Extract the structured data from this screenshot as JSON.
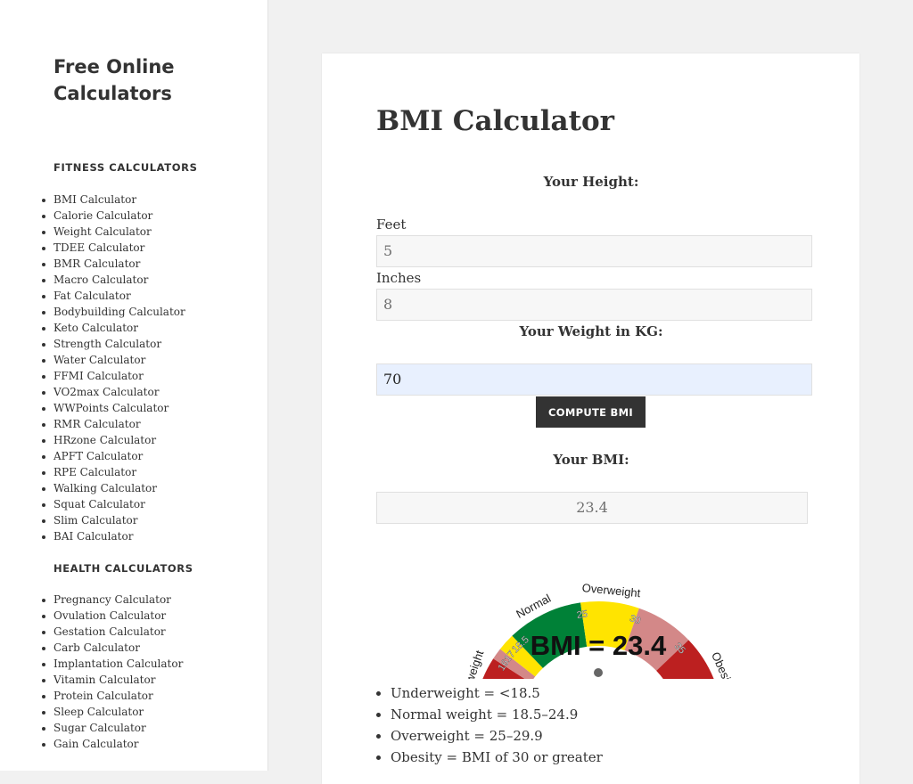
{
  "site": {
    "title_line1": "Free Online",
    "title_line2": "Calculators"
  },
  "sidebar": {
    "fitness_title": "FITNESS CALCULATORS",
    "fitness_items": [
      "BMI Calculator",
      "Calorie Calculator",
      "Weight Calculator",
      "TDEE Calculator",
      "BMR Calculator",
      "Macro Calculator",
      "Fat Calculator",
      "Bodybuilding Calculator",
      "Keto Calculator",
      "Strength Calculator",
      "Water Calculator",
      "FFMI Calculator",
      "VO2max Calculator",
      "WWPoints Calculator",
      "RMR Calculator",
      "HRzone Calculator",
      "APFT Calculator",
      "RPE Calculator",
      "Walking Calculator",
      "Squat Calculator",
      "Slim Calculator",
      "BAI Calculator"
    ],
    "health_title": "HEALTH CALCULATORS",
    "health_items": [
      "Pregnancy Calculator",
      "Ovulation Calculator",
      "Gestation Calculator",
      "Carb Calculator",
      "Implantation Calculator",
      "Vitamin Calculator",
      "Protein Calculator",
      "Sleep Calculator",
      "Sugar Calculator",
      "Gain Calculator"
    ]
  },
  "main": {
    "title": "BMI Calculator",
    "height_label": "Your Height:",
    "feet_label": "Feet",
    "feet_value": "5",
    "inches_label": "Inches",
    "inches_value": "8",
    "weight_label": "Your Weight in KG:",
    "weight_value": "70",
    "compute_button": "COMPUTE BMI",
    "result_label": "Your BMI:",
    "result_value": "23.4"
  },
  "gauge": {
    "readout": "BMI = 23.4",
    "value": 23.4,
    "min": 10,
    "max": 43,
    "category_labels": [
      "Underweight",
      "Normal",
      "Overweight",
      "Obesity"
    ],
    "tick_labels": [
      "16",
      "17",
      "18.5",
      "25",
      "30",
      "35",
      "40"
    ],
    "colors": {
      "severe_under": "#bc2020",
      "moderate_under": "#d38888",
      "mild_under": "#ffe400",
      "normal": "#008137",
      "overweight": "#ffe400",
      "obese1": "#d38888",
      "obese2": "#bc2020",
      "obese3": "#8a0101"
    }
  },
  "ranges": [
    "Underweight = <18.5",
    "Normal weight = 18.5–24.9",
    "Overweight = 25–29.9",
    "Obesity = BMI of 30 or greater"
  ]
}
